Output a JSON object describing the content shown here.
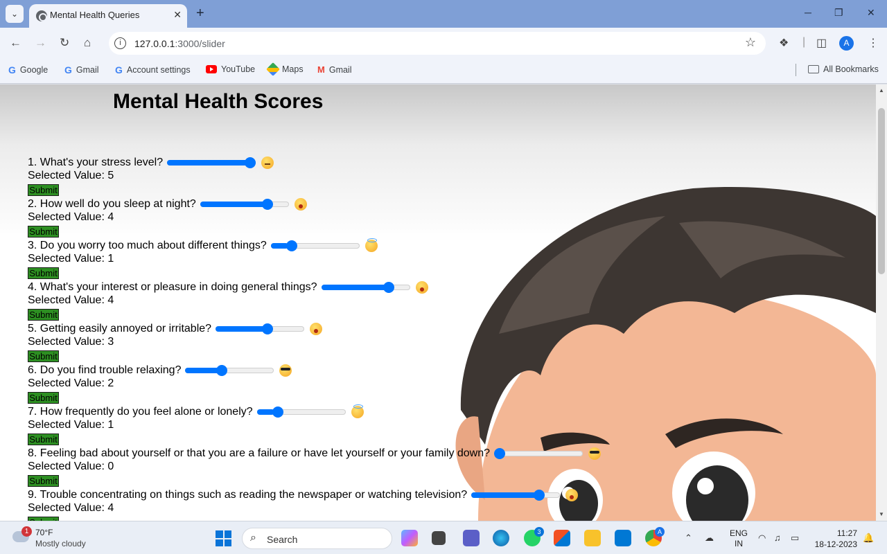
{
  "browser": {
    "tab_title": "Mental Health Queries",
    "url_host": "127.0.0.1",
    "url_path": ":3000/slider",
    "bookmarks": [
      {
        "label": "Google",
        "icon": "google-icon"
      },
      {
        "label": "Gmail",
        "icon": "google-icon"
      },
      {
        "label": "Account settings",
        "icon": "google-icon"
      },
      {
        "label": "YouTube",
        "icon": "youtube-icon"
      },
      {
        "label": "Maps",
        "icon": "maps-icon"
      },
      {
        "label": "Gmail",
        "icon": "gmail-icon"
      }
    ],
    "all_bookmarks": "All Bookmarks",
    "avatar_letter": "A"
  },
  "page": {
    "title": "Mental Health Scores",
    "selected_prefix": "Selected Value: ",
    "submit_label": "Submit",
    "slider_max": 5,
    "accent": "#0075ff",
    "submit_color": "#2d8f22",
    "questions": [
      {
        "text": "1. What's your stress level?",
        "value": 5,
        "emoji": "thinking-face-icon"
      },
      {
        "text": "2. How well do you sleep at night?",
        "value": 4,
        "emoji": "astonished-face-icon"
      },
      {
        "text": "3. Do you worry too much about different things?",
        "value": 1,
        "emoji": "halo-face-icon"
      },
      {
        "text": "4. What's your interest or pleasure in doing general things?",
        "value": 4,
        "emoji": "astonished-face-icon"
      },
      {
        "text": "5. Getting easily annoyed or irritable?",
        "value": 3,
        "emoji": "bandage-face-icon"
      },
      {
        "text": "6. Do you find trouble relaxing?",
        "value": 2,
        "emoji": "sunglasses-face-icon"
      },
      {
        "text": "7. How frequently do you feel alone or lonely?",
        "value": 1,
        "emoji": "halo-face-icon"
      },
      {
        "text": "8. Feeling bad about yourself or that you are a failure or have let yourself or your family down?",
        "value": 0,
        "emoji": "sunglasses-face-icon"
      },
      {
        "text": "9. Trouble concentrating on things such as reading the newspaper or watching television?",
        "value": 4,
        "emoji": "astonished-face-icon"
      }
    ]
  },
  "taskbar": {
    "weather_temp": "70°F",
    "weather_desc": "Mostly cloudy",
    "weather_badge": "1",
    "search_placeholder": "Search",
    "whatsapp_badge": "3",
    "lang_line1": "ENG",
    "lang_line2": "IN",
    "time": "11:27",
    "date": "18-12-2023"
  }
}
